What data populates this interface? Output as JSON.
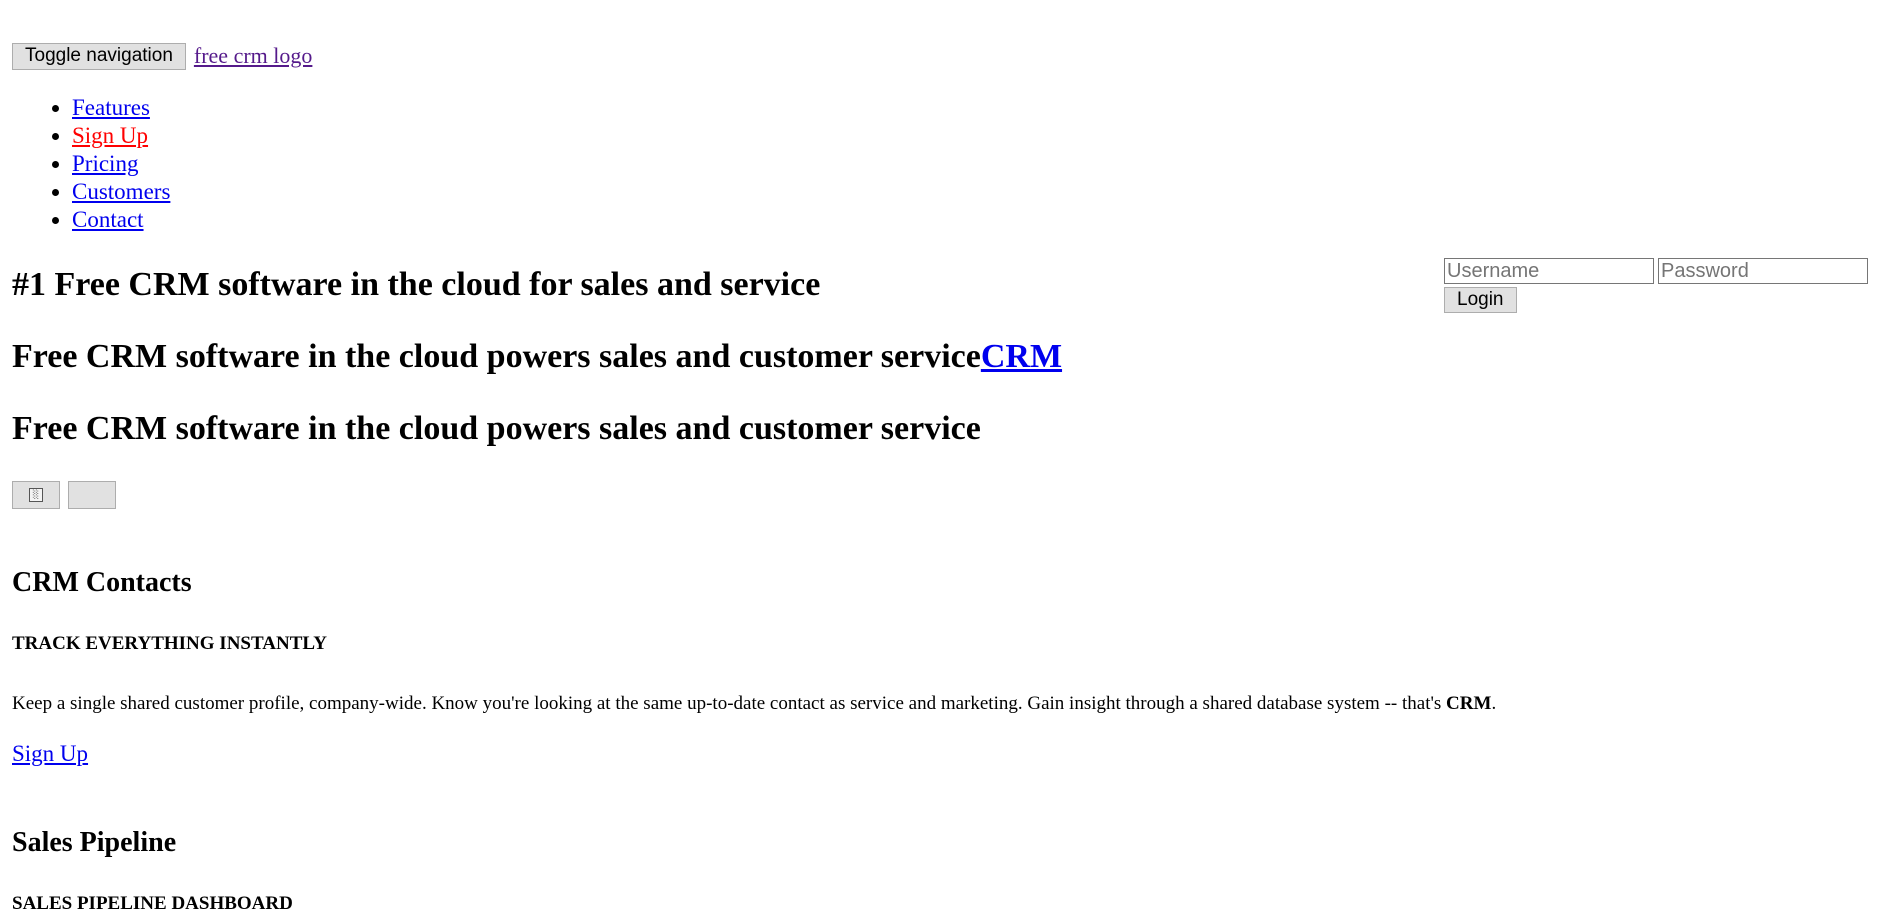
{
  "navbar": {
    "toggle_label": "Toggle navigation",
    "brand_text": "free crm logo"
  },
  "nav": {
    "items": [
      {
        "label": "Features"
      },
      {
        "label": "Sign Up"
      },
      {
        "label": "Pricing"
      },
      {
        "label": "Customers"
      },
      {
        "label": "Contact"
      }
    ]
  },
  "login": {
    "username_placeholder": "Username",
    "password_placeholder": "Password",
    "button_label": "Login"
  },
  "hero": {
    "title": "#1 Free CRM software in the cloud for sales and service",
    "subtitle": "Free CRM software in the cloud powers sales and customer service",
    "subtitle_link": "CRM",
    "subtitle_repeat": "Free CRM software in the cloud powers sales and customer service"
  },
  "carousel": {
    "prev_icon": "broken-image-icon",
    "next_icon": ""
  },
  "features": [
    {
      "title": "CRM Contacts",
      "kicker": "TRACK EVERYTHING INSTANTLY",
      "text_before": "Keep a single shared customer profile, company-wide. Know you're looking at the same up-to-date contact as service and marketing. Gain insight through a shared database system -- that's ",
      "text_bold": "CRM",
      "text_after": ".",
      "link": "Sign Up"
    },
    {
      "title": "Sales Pipeline",
      "kicker": "SALES PIPELINE DASHBOARD"
    }
  ],
  "colors": {
    "link": "#0000ee",
    "visited_link": "#551a8b",
    "signup_link": "#ff0000",
    "button_bg": "#e1e1e1"
  }
}
